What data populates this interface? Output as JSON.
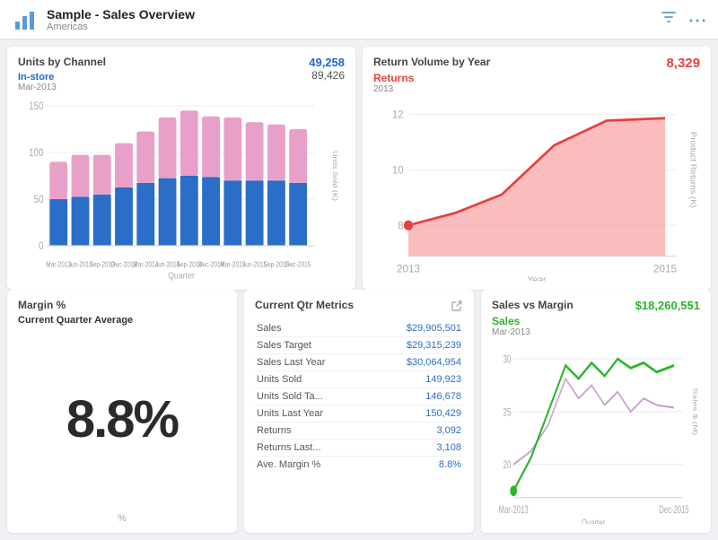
{
  "header": {
    "title": "Sample - Sales Overview",
    "subtitle": "Americas",
    "filter_tooltip": "Filter",
    "more_tooltip": "More options"
  },
  "units_by_channel": {
    "title": "Units by Channel",
    "legend_label": "In-store",
    "period": "Mar-2013",
    "value_blue": "49,258",
    "value_total": "89,426",
    "x_axis_label": "Quarter",
    "y_axis_label": "Units Sold (K)",
    "y_axis_values": [
      "150",
      "100",
      "50",
      "0"
    ],
    "bars": [
      {
        "label": "Mar-2013",
        "blue": 50,
        "pink": 40
      },
      {
        "label": "Jun-2013",
        "blue": 52,
        "pink": 45
      },
      {
        "label": "Sep-2013",
        "blue": 55,
        "pink": 42
      },
      {
        "label": "Dec-2013",
        "blue": 62,
        "pink": 48
      },
      {
        "label": "Mar-2014",
        "blue": 68,
        "pink": 55
      },
      {
        "label": "Jun-2014",
        "blue": 72,
        "pink": 65
      },
      {
        "label": "Sep-2014",
        "blue": 75,
        "pink": 70
      },
      {
        "label": "Dec-2014",
        "blue": 73,
        "pink": 65
      },
      {
        "label": "Mar-2015",
        "blue": 70,
        "pink": 68
      },
      {
        "label": "Jun-2015",
        "blue": 68,
        "pink": 62
      },
      {
        "label": "Sep-2015",
        "blue": 70,
        "pink": 60
      },
      {
        "label": "Dec-2015",
        "blue": 68,
        "pink": 58
      }
    ]
  },
  "return_volume": {
    "title": "Return Volume by Year",
    "legend_label": "Returns",
    "year": "2013",
    "value": "8,329",
    "x_axis_label": "Year",
    "y_axis_label": "Product Returns (K)",
    "y_axis_values": [
      "12",
      "10",
      "8"
    ],
    "x_axis_values": [
      "2013",
      "2015"
    ]
  },
  "margin": {
    "title": "Margin %",
    "subtitle": "Current Quarter Average",
    "value": "8.8%",
    "bottom_label": "%"
  },
  "current_metrics": {
    "title": "Current Qtr Metrics",
    "rows": [
      {
        "label": "Sales",
        "value": "$29,905,501"
      },
      {
        "label": "Sales Target",
        "value": "$29,315,239"
      },
      {
        "label": "Sales Last Year",
        "value": "$30,064,954"
      },
      {
        "label": "Units Sold",
        "value": "149,923"
      },
      {
        "label": "Units Sold Ta...",
        "value": "146,678"
      },
      {
        "label": "Units Last Year",
        "value": "150,429"
      },
      {
        "label": "Returns",
        "value": "3,092"
      },
      {
        "label": "Returns Last...",
        "value": "3,108"
      },
      {
        "label": "Ave. Margin %",
        "value": "8.8%"
      }
    ]
  },
  "sales_vs_margin": {
    "title": "Sales vs Margin",
    "legend_label": "Sales",
    "period": "Mar-2013",
    "value": "$18,260,551",
    "x_axis_label": "Quarter",
    "y_axis_label": "Sales $ (M)",
    "x_axis_values": [
      "Mar-2013",
      "Dec-2015"
    ],
    "y_axis_values": [
      "30",
      "25",
      "20"
    ]
  }
}
